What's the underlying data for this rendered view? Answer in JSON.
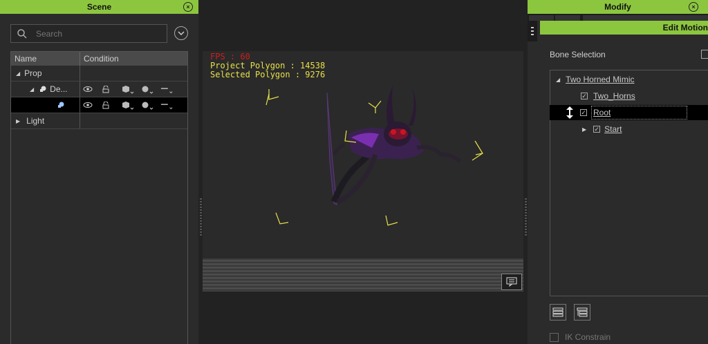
{
  "scene_panel": {
    "title": "Scene",
    "search_placeholder": "Search",
    "columns": [
      "Name",
      "Condition"
    ],
    "rows": [
      {
        "name": "Prop"
      },
      {
        "name": "De..."
      },
      {
        "name": ""
      },
      {
        "name": "Light"
      }
    ]
  },
  "viewport": {
    "fps": "FPS : 60",
    "project_polygon": "Project Polygon : 14538",
    "selected_polygon": "Selected Polygon : 9276"
  },
  "modify_panel": {
    "title": "Modify",
    "edit_motion_title": "Edit Motion",
    "bone_selection_label": "Bone Selection",
    "bones": [
      {
        "name": "Two Horned Mimic"
      },
      {
        "name": "Two_Horns"
      },
      {
        "name": "Root"
      },
      {
        "name": "Start"
      }
    ],
    "ik_constrain_label": "IK Constrain"
  },
  "colors": {
    "accent_green": "#8cc63f",
    "fps_red": "#cc1e1e",
    "stats_yellow": "#e8e04a"
  }
}
